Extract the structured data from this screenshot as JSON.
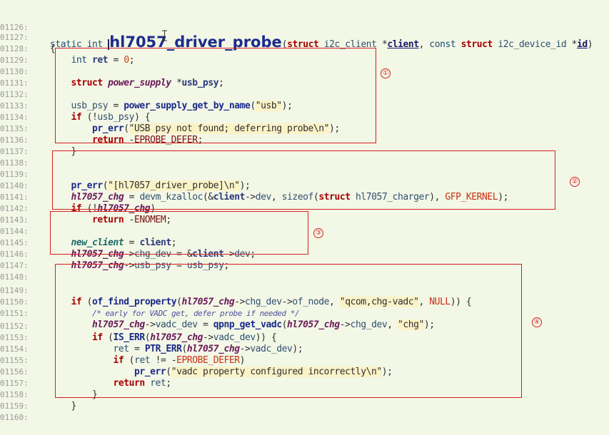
{
  "editor": {
    "function_name": "hl7057_driver_probe",
    "lines": [
      {
        "no": "01126:"
      },
      {
        "no": "01127:"
      },
      {
        "no": "01128:"
      },
      {
        "no": "01129:"
      },
      {
        "no": "01130:"
      },
      {
        "no": "01131:"
      },
      {
        "no": "01132:"
      },
      {
        "no": "01133:"
      },
      {
        "no": "01134:"
      },
      {
        "no": "01135:"
      },
      {
        "no": "01136:"
      },
      {
        "no": "01137:"
      },
      {
        "no": "01138:"
      },
      {
        "no": "01139:"
      },
      {
        "no": "01140:"
      },
      {
        "no": "01141:"
      },
      {
        "no": "01142:"
      },
      {
        "no": "01143:"
      },
      {
        "no": "01144:"
      },
      {
        "no": "01145:"
      },
      {
        "no": "01146:"
      },
      {
        "no": "01147:"
      },
      {
        "no": "01148:"
      },
      {
        "no": "01149:"
      },
      {
        "no": "01150:"
      },
      {
        "no": "01151:"
      },
      {
        "no": "01152:"
      },
      {
        "no": "01153:"
      },
      {
        "no": "01154:"
      },
      {
        "no": "01155:"
      },
      {
        "no": "01156:"
      },
      {
        "no": "01157:"
      },
      {
        "no": "01158:"
      },
      {
        "no": "01159:"
      },
      {
        "no": "01160:"
      }
    ],
    "tokens": {
      "static": "static",
      "int": "int",
      "struct": "struct",
      "const": "const",
      "i2c_client": "i2c_client",
      "i2c_device_id": "i2c_device_id",
      "client": "client",
      "id": "id",
      "ret": "ret",
      "zero": "0",
      "power_supply": "power_supply",
      "usb_psy": "usb_psy",
      "power_supply_get_by_name": "power_supply_get_by_name",
      "str_usb": "\"usb\"",
      "if": "if",
      "return": "return",
      "pr_err": "pr_err",
      "str_usb_not_found": "\"USB psy not found; deferring probe\\n\"",
      "EPROBE_DEFER": "EPROBE_DEFER",
      "str_probe": "\"[hl7057_driver_probe]\\n\"",
      "hl7057_chg": "hl7057_chg",
      "devm_kzalloc": "devm_kzalloc",
      "dev": "dev",
      "sizeof": "sizeof",
      "hl7057_charger": "hl7057_charger",
      "GFP_KERNEL": "GFP_KERNEL",
      "ENOMEM": "ENOMEM",
      "new_client": "new_client",
      "chg_dev": "chg_dev",
      "of_find_property": "of_find_property",
      "of_node": "of_node",
      "str_qcom": "\"qcom,chg-vadc\"",
      "NULL": "NULL",
      "comment_vadc": "/* early for VADC get, defer probe if needed */",
      "vadc_dev": "vadc_dev",
      "qpnp_get_vadc": "qpnp_get_vadc",
      "str_chg": "\"chg\"",
      "IS_ERR": "IS_ERR",
      "PTR_ERR": "PTR_ERR",
      "str_vadc_err": "\"vadc property configured incorrectly\\n\""
    },
    "annotations": [
      "①",
      "②",
      "③",
      "④"
    ],
    "colors": {
      "background": "#f3f7e6",
      "annotation": "#d42020",
      "keyword": "#a40000",
      "function": "#1a2a8a",
      "string_bg": "#fbf3c8"
    }
  }
}
